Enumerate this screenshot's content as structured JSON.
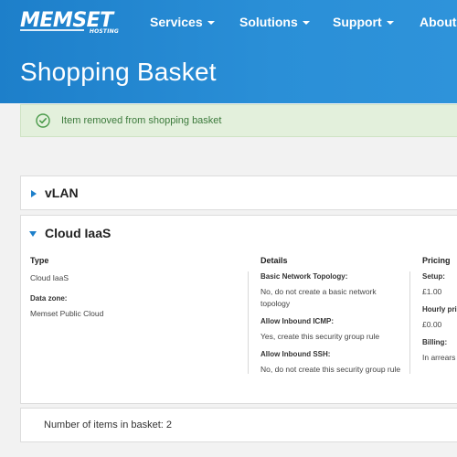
{
  "header": {
    "logo_text": "MEMSET",
    "logo_sub": "HOSTING",
    "nav": [
      {
        "label": "Services"
      },
      {
        "label": "Solutions"
      },
      {
        "label": "Support"
      },
      {
        "label": "About"
      }
    ],
    "page_title": "Shopping Basket"
  },
  "alert": {
    "message": "Item removed from shopping basket",
    "color": "#3c7a3c"
  },
  "basket": {
    "items": [
      {
        "name": "vLAN",
        "expanded": false
      },
      {
        "name": "Cloud IaaS",
        "expanded": true
      }
    ],
    "cloud": {
      "type_heading": "Type",
      "type_value": "Cloud IaaS",
      "zone_label": "Data zone:",
      "zone_value": "Memset Public Cloud",
      "details_heading": "Details",
      "details": [
        {
          "label": "Basic Network Topology:",
          "value": "No, do not create a basic network topology"
        },
        {
          "label": "Allow Inbound ICMP:",
          "value": "Yes, create this security group rule"
        },
        {
          "label": "Allow Inbound SSH:",
          "value": "No, do not create this security group rule"
        }
      ],
      "pricing_heading": "Pricing",
      "pricing": [
        {
          "label": "Setup:",
          "value": "£1.00"
        },
        {
          "label": "Hourly pri",
          "value": "£0.00"
        },
        {
          "label": "Billing:",
          "value": "In arrears"
        }
      ]
    },
    "count_text": "Number of items in basket: 2"
  },
  "colors": {
    "header_blue": "#1d7fca",
    "alert_bg": "#e3f0dc"
  }
}
